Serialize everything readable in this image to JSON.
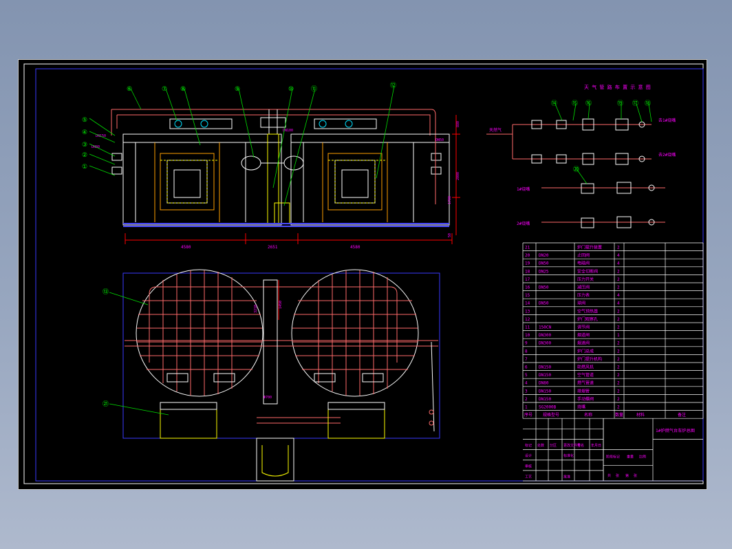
{
  "colors": {
    "background": "#000000",
    "frame": "#3a3aff",
    "outline": "#ffffff",
    "pipe": "#ff6a6a",
    "leader": "#00e000",
    "callout": "#00ff00",
    "text": "#ff00ff",
    "dimension": "#ff0000",
    "brick": "#ffa000",
    "dashed": "#ffff00",
    "floor": "#4a4aff"
  },
  "views": {
    "elevation_dims": [
      "4580",
      "2651",
      "4580"
    ],
    "right_dims": [
      "880",
      "2000",
      "1700",
      "50"
    ],
    "pipe_dims": [
      "DN150",
      "DN80",
      "DN100",
      "DN50"
    ],
    "plan_dims": [
      "Φ700",
      "1450",
      "3210"
    ]
  },
  "callouts": {
    "elevation_top": [
      "⑥",
      "⑦",
      "⑧",
      "⑨",
      "⑩",
      "⑪",
      "⑫"
    ],
    "elevation_left": [
      "⑤",
      "④",
      "③",
      "②",
      "①"
    ],
    "plan": [
      "⑬",
      "㉑"
    ],
    "schematic": [
      "⑭",
      "⑮",
      "⑯",
      "⑲",
      "⑰",
      "⑱",
      "⑳"
    ]
  },
  "schematic": {
    "title": "天 气 管 路 布 置 示 意 图",
    "inlet_label": "天然气",
    "line1": "1#烧嘴",
    "line2": "2#烧嘴",
    "out1": "去1#烧嘴",
    "out2": "去2#烧嘴"
  },
  "bom": {
    "rows": [
      {
        "no": "21",
        "spec": "",
        "name": "炉门提升装置",
        "qty": "2"
      },
      {
        "no": "20",
        "spec": "DN20",
        "name": "止回阀",
        "qty": "4"
      },
      {
        "no": "19",
        "spec": "DN50",
        "name": "电磁阀",
        "qty": "4"
      },
      {
        "no": "18",
        "spec": "DN25",
        "name": "安全切断阀",
        "qty": "2"
      },
      {
        "no": "17",
        "spec": "",
        "name": "压力开关",
        "qty": "2"
      },
      {
        "no": "16",
        "spec": "DN50",
        "name": "减压阀",
        "qty": "2"
      },
      {
        "no": "15",
        "spec": "",
        "name": "压力表",
        "qty": "4"
      },
      {
        "no": "14",
        "spec": "DN50",
        "name": "球阀",
        "qty": "4"
      },
      {
        "no": "13",
        "spec": "",
        "name": "空气预热器",
        "qty": "2"
      },
      {
        "no": "12",
        "spec": "",
        "name": "炉门观察孔",
        "qty": "2"
      },
      {
        "no": "11",
        "spec": "150CN",
        "name": "调节阀",
        "qty": "2"
      },
      {
        "no": "10",
        "spec": "DN300",
        "name": "烟道闸",
        "qty": "1"
      },
      {
        "no": "9",
        "spec": "DN300",
        "name": "烟道阀",
        "qty": "2"
      },
      {
        "no": "8",
        "spec": "",
        "name": "炉门总成",
        "qty": "2"
      },
      {
        "no": "7",
        "spec": "",
        "name": "炉门提升机构",
        "qty": "2"
      },
      {
        "no": "6",
        "spec": "DN150",
        "name": "助燃风机",
        "qty": "2"
      },
      {
        "no": "5",
        "spec": "DN150",
        "name": "空气管道",
        "qty": "2"
      },
      {
        "no": "4",
        "spec": "DN80",
        "name": "燃气管道",
        "qty": "2"
      },
      {
        "no": "3",
        "spec": "DN150",
        "name": "排烟管",
        "qty": "2"
      },
      {
        "no": "2",
        "spec": "DN150",
        "name": "手动蝶阀",
        "qty": "2"
      },
      {
        "no": "1",
        "spec": "SG2000B",
        "name": "烧嘴",
        "qty": "2"
      }
    ],
    "headers": {
      "no": "序号",
      "spec": "规格型号",
      "name": "名称",
      "qty": "数量",
      "material": "材料",
      "note": "备注"
    },
    "title_text": "1#炉燃气台车炉总图",
    "tb_labels": [
      "标记",
      "处数",
      "分区",
      "更改文件号",
      "签名",
      "年月日",
      "设计",
      "标准化",
      "审核",
      "工艺",
      "批准",
      "阶段标记",
      "重量",
      "比例",
      "共",
      "张",
      "第",
      "张"
    ]
  }
}
